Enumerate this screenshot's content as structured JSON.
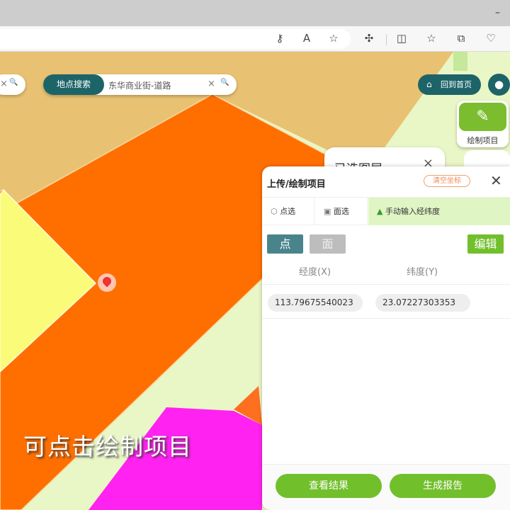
{
  "browser": {
    "toolbar_icons": [
      "key-icon",
      "read-aloud-icon",
      "favorite-star-icon",
      "extensions-icon",
      "split-screen-icon",
      "favorites-list-icon",
      "collections-icon",
      "browser-health-icon"
    ],
    "minimize": "–"
  },
  "map": {
    "search_left": {
      "clear": "×",
      "search": "🔍"
    },
    "search": {
      "tag": "地点搜索",
      "value": "东华商业街-道路",
      "clear": "×",
      "search": "🔍"
    },
    "home_button": "回到首页",
    "draw_tool": {
      "label": "绘制项目"
    },
    "behind_panel": {
      "title": "已选图层",
      "close": "×"
    },
    "colors": {
      "tan": "#e8c272",
      "orange": "#ff6f00",
      "yellow": "#fbfb7a",
      "light_green": "#ecf8c8",
      "magenta": "#ff22f0",
      "teal": "#1d6468",
      "green": "#72bf2c"
    }
  },
  "panel": {
    "title": "上传/绘制项目",
    "clear_coords": "清空坐标",
    "close": "✕",
    "tabs": [
      {
        "label": "点选",
        "icon": "point-select-icon"
      },
      {
        "label": "面选",
        "icon": "area-select-icon"
      },
      {
        "label": "手动输入经纬度",
        "icon": "north-arrow-icon",
        "active": true
      }
    ],
    "mode_point": "点",
    "mode_face": "面",
    "edit": "编辑",
    "columns": [
      "经度(X)",
      "纬度(Y)"
    ],
    "row": {
      "lng": "113.79675540023",
      "lat": "23.07227303353"
    },
    "view_results": "查看结果",
    "generate_report": "生成报告"
  },
  "caption": "可点击绘制项目"
}
